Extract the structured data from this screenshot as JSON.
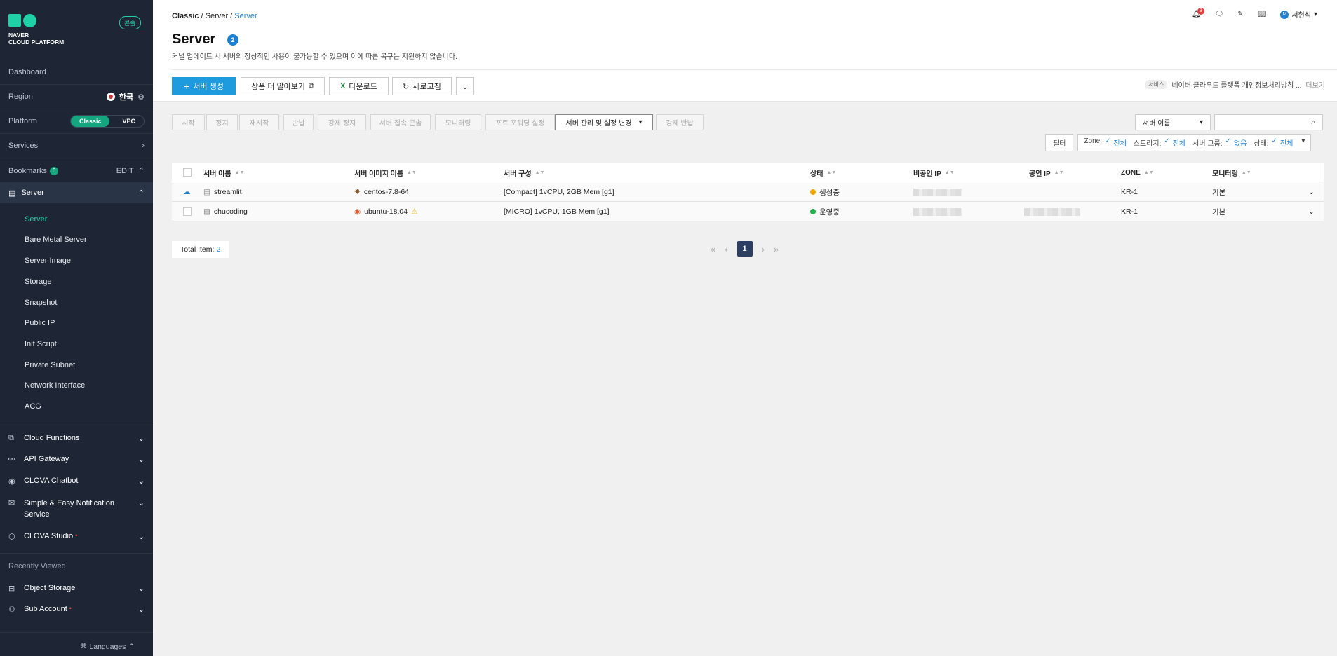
{
  "brand": {
    "line1": "NAVER",
    "line2": "CLOUD PLATFORM",
    "console_badge": "콘솔"
  },
  "sidebar": {
    "dashboard": "Dashboard",
    "region_label": "Region",
    "region_value": "한국",
    "platform_label": "Platform",
    "platform_opts": [
      "Classic",
      "VPC"
    ],
    "services": "Services",
    "bookmarks": "Bookmarks",
    "bookmarks_count": "6",
    "edit": "EDIT",
    "server_header": "Server",
    "server_items": [
      "Server",
      "Bare Metal Server",
      "Server Image",
      "Storage",
      "Snapshot",
      "Public IP",
      "Init Script",
      "Private Subnet",
      "Network Interface",
      "ACG"
    ],
    "categories": [
      "Cloud Functions",
      "API Gateway",
      "CLOVA Chatbot",
      "Simple & Easy Notification Service",
      "CLOVA Studio"
    ],
    "recently_viewed": "Recently Viewed",
    "recent_items": [
      "Object Storage",
      "Sub Account"
    ],
    "languages": "Languages"
  },
  "header": {
    "breadcrumb": [
      "Classic",
      "Server",
      "Server"
    ],
    "title": "Server",
    "count": "2",
    "desc": "커널 업데이트 시 서버의 정상적인 사용이 불가능할 수 있으며 이에 따른 복구는 지원하지 않습니다.",
    "notif_count": "8",
    "user_initial": "M",
    "user": "서현석"
  },
  "toolbar": {
    "create": "서버 생성",
    "learn": "상품 더 알아보기",
    "download": "다운로드",
    "refresh": "새로고침",
    "service_tag": "서비스",
    "service_text": "네이버 클라우드 플랫폼 개인정보처리방침 ...",
    "more": "더보기"
  },
  "actions": {
    "buttons": [
      "시작",
      "정지",
      "재시작",
      "반납",
      "강제 정지",
      "서버 접속 콘솔",
      "모니터링",
      "포트 포워딩 설정"
    ],
    "manage": "서버 관리 및 설정 변경",
    "force_return": "강제 반납",
    "search_select": "서버 이름",
    "search_placeholder": ""
  },
  "filter": {
    "label": "필터",
    "zone": "Zone:",
    "zone_v": "전체",
    "storage": "스토리지:",
    "storage_v": "전체",
    "group": "서버 그룹:",
    "group_v": "없음",
    "status": "상태:",
    "status_v": "전체"
  },
  "table": {
    "headers": [
      "서버 이름",
      "서버 이미지 이름",
      "서버 구성",
      "상태",
      "비공인 IP",
      "공인 IP",
      "ZONE",
      "모니터링"
    ],
    "rows": [
      {
        "name": "streamlit",
        "image": "centos-7.8-64",
        "spec": "[Compact] 1vCPU, 2GB Mem [g1]",
        "status": "생성중",
        "status_color": "#f0a500",
        "zone": "KR-1",
        "monitor": "기본"
      },
      {
        "name": "chucoding",
        "image": "ubuntu-18.04",
        "spec": "[MICRO] 1vCPU, 1GB Mem [g1]",
        "status": "운영중",
        "status_color": "#22b14c",
        "zone": "KR-1",
        "monitor": "기본"
      }
    ]
  },
  "footer": {
    "total_label": "Total Item:",
    "total": "2",
    "page": "1"
  }
}
